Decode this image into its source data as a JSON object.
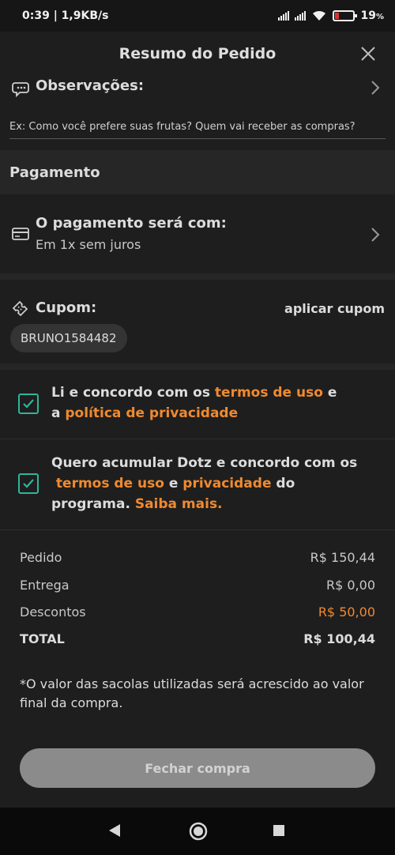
{
  "status_bar": {
    "time": "0:39 | 1,9KB/s",
    "battery": "19",
    "battery_level": 0.19
  },
  "header": {
    "title": "Resumo do Pedido"
  },
  "observations": {
    "label": "Observações:",
    "placeholder": "Ex: Como você prefere suas frutas? Quem vai receber as compras?"
  },
  "payment": {
    "section_title": "Pagamento",
    "title": "O pagamento será com:",
    "subtitle": "Em 1x sem juros"
  },
  "coupon": {
    "label": "Cupom:",
    "apply_label": "aplicar cupom",
    "code": "BRUNO1584482"
  },
  "terms": {
    "pre": "Li e concordo com os ",
    "link1": "termos de uso",
    "mid": " e",
    "pre2": "a ",
    "link2": "política de privacidade",
    "checked": true
  },
  "dotz": {
    "line1": "Quero acumular Dotz e concordo com os",
    "link1": "termos de uso",
    "mid": " e ",
    "link2": "privacidade",
    "after": " do",
    "line3_pre": "programa. ",
    "link3": "Saiba mais.",
    "checked": true
  },
  "summary": {
    "order_label": "Pedido",
    "order_value": "R$ 150,44",
    "delivery_label": "Entrega",
    "delivery_value": "R$ 0,00",
    "discount_label": "Descontos",
    "discount_value": "R$ 50,00",
    "total_label": "TOTAL",
    "total_value": "R$ 100,44",
    "note": "*O valor das sacolas utilizadas será acrescido ao valor final da compra."
  },
  "checkout": {
    "button_label": "Fechar compra"
  },
  "colors": {
    "accent_orange": "#f08a30",
    "checkbox_green": "#2fb59a",
    "background": "#1e1e1e"
  }
}
